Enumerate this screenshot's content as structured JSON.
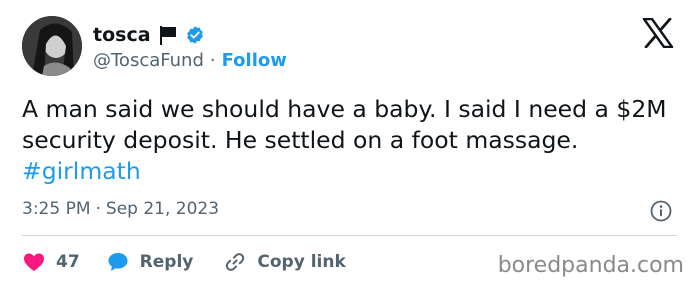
{
  "user": {
    "name": "tosca",
    "handle": "@ToscaFund",
    "separator": "·",
    "follow_label": "Follow"
  },
  "tweet": {
    "text": "A man said we should have a baby. I said I need a $2M security deposit. He settled on a foot massage. ",
    "hashtag": "#girlmath",
    "time": "3:25 PM",
    "date_separator": "·",
    "date": "Sep 21, 2023"
  },
  "actions": {
    "like_count": "47",
    "reply_label": "Reply",
    "copy_label": "Copy link"
  },
  "watermark": "boredpanda.com",
  "icons": {
    "logo": "x-logo-icon",
    "flag": "flag-icon",
    "verified": "verified-badge-icon",
    "info": "info-icon",
    "like": "heart-icon",
    "reply": "speech-bubble-icon",
    "copy": "link-icon"
  },
  "colors": {
    "accent": "#1d9bf0",
    "like": "#f91880",
    "muted": "#536471",
    "text": "#0f1419"
  }
}
